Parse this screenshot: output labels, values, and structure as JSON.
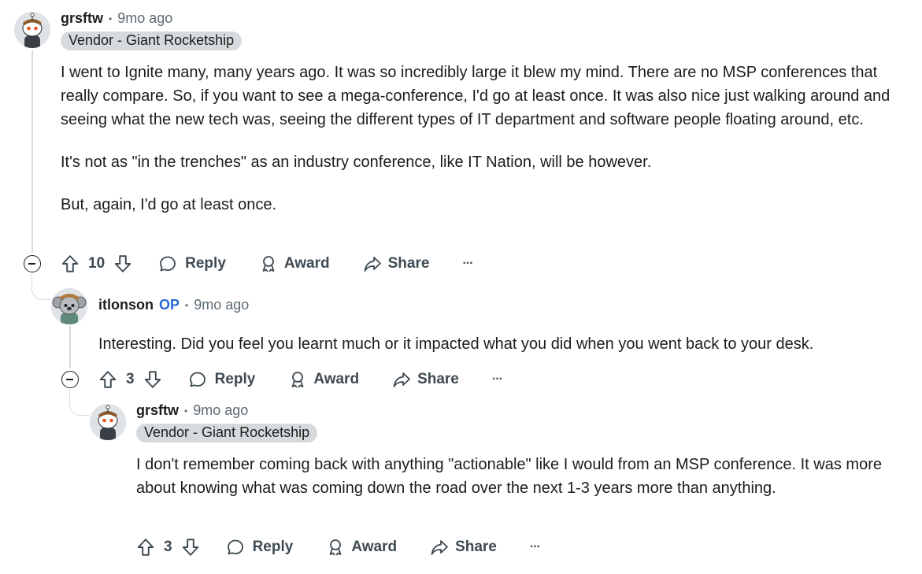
{
  "comments": [
    {
      "username": "grsftw",
      "sep": "•",
      "time": "9mo ago",
      "flair": "Vendor - Giant Rocketship",
      "paragraphs": [
        "I went to Ignite many, many years ago. It was so incredibly large it blew my mind. There are no MSP conferences that really compare. So, if you want to see a mega-conference, I'd go at least once. It was also nice just walking around and seeing what the new tech was, seeing the different types of IT department and software people floating around, etc.",
        "It's not as \"in the trenches\" as an industry conference, like IT Nation, will be however.",
        "But, again, I'd go at least once."
      ],
      "votes": "10",
      "reply_label": "Reply",
      "award_label": "Award",
      "share_label": "Share",
      "more_label": "···"
    },
    {
      "username": "itlonson",
      "op_badge": "OP",
      "sep": "•",
      "time": "9mo ago",
      "paragraphs": [
        "Interesting. Did you feel you learnt much or it impacted what you did when you went back to your desk."
      ],
      "votes": "3",
      "reply_label": "Reply",
      "award_label": "Award",
      "share_label": "Share",
      "more_label": "···"
    },
    {
      "username": "grsftw",
      "sep": "•",
      "time": "9mo ago",
      "flair": "Vendor - Giant Rocketship",
      "paragraphs": [
        "I don't remember coming back with anything \"actionable\" like I would from an MSP conference. It was more about knowing what was coming down the road over the next 1-3 years more than anything."
      ],
      "votes": "3",
      "reply_label": "Reply",
      "award_label": "Award",
      "share_label": "Share",
      "more_label": "···"
    }
  ]
}
